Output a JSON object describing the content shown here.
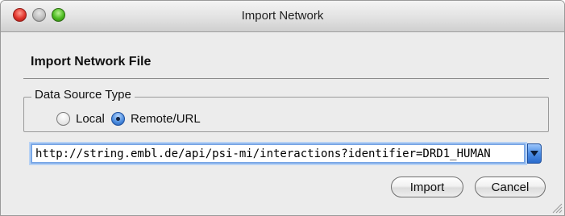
{
  "window": {
    "title": "Import Network"
  },
  "panel": {
    "heading": "Import Network File"
  },
  "data_source": {
    "legend": "Data Source Type",
    "options": [
      {
        "label": "Local",
        "selected": false
      },
      {
        "label": "Remote/URL",
        "selected": true
      }
    ]
  },
  "url_field": {
    "value": "http://string.embl.de/api/psi-mi/interactions?identifier=DRD1_HUMAN"
  },
  "buttons": {
    "import": "Import",
    "cancel": "Cancel"
  },
  "colors": {
    "accent": "#4c8de4",
    "window_bg": "#ececec"
  },
  "icons": [
    "close-window-icon",
    "minimize-window-icon",
    "zoom-window-icon",
    "chevron-down-icon",
    "resize-grip-icon"
  ]
}
